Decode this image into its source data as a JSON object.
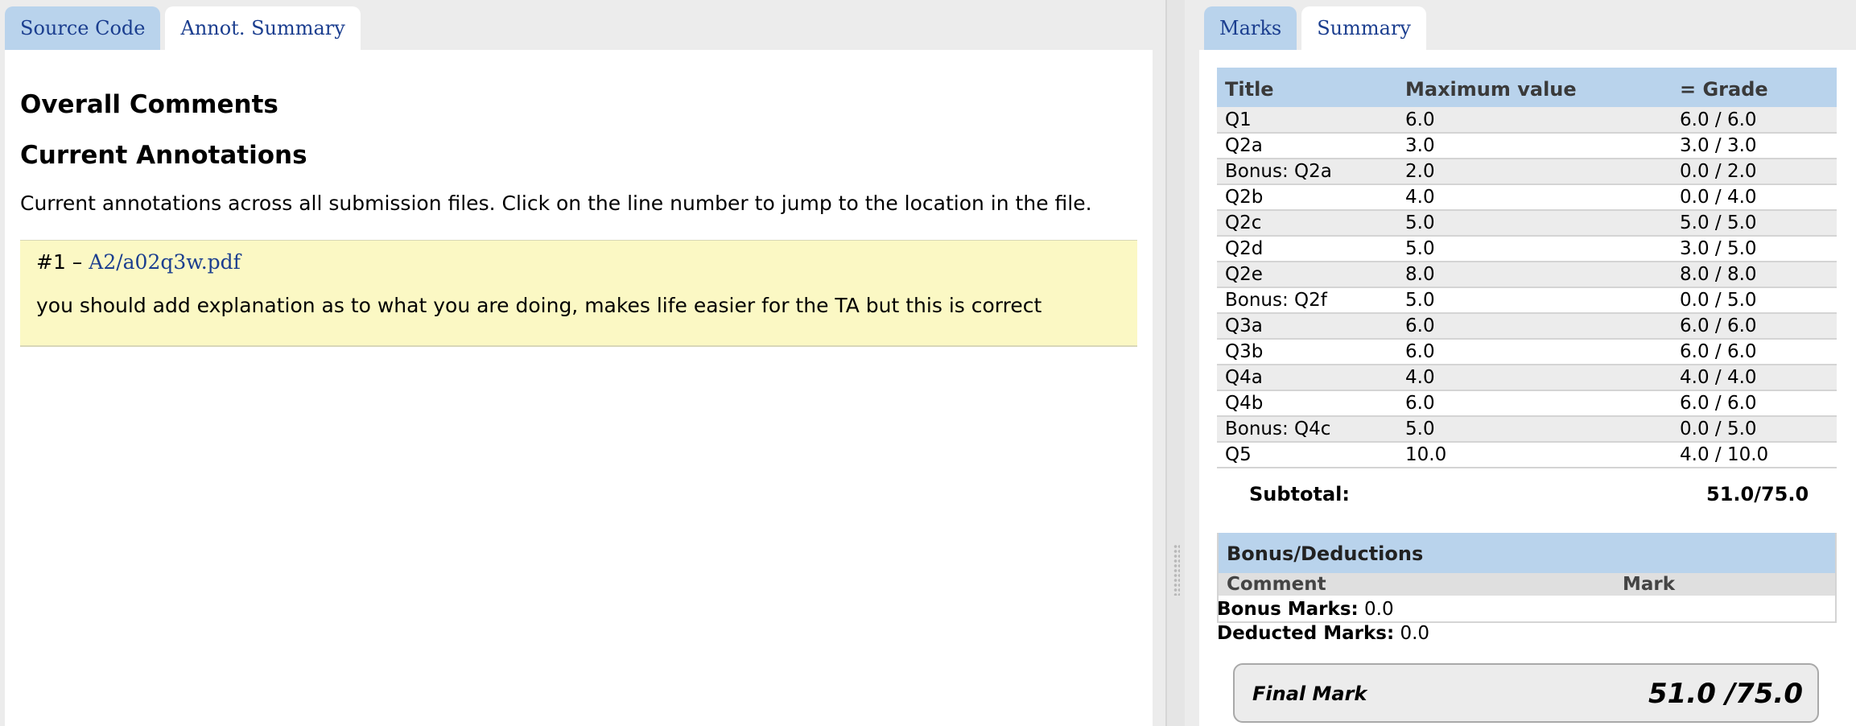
{
  "left_tabs": [
    {
      "label": "Source Code"
    },
    {
      "label": "Annot. Summary"
    }
  ],
  "left": {
    "overall_heading": "Overall Comments",
    "current_heading": "Current Annotations",
    "intro": "Current annotations across all submission files. Click on the line number to jump to the location in the file.",
    "annotation": {
      "number": "#1 –",
      "file_link": "A2/a02q3w.pdf",
      "text": "you should add explanation as to what you are doing, makes life easier for the TA but this is correct"
    }
  },
  "right_tabs": [
    {
      "label": "Marks"
    },
    {
      "label": "Summary"
    }
  ],
  "summary": {
    "headers": {
      "title": "Title",
      "max": "Maximum value",
      "grade": "= Grade"
    },
    "rows": [
      {
        "title": "Q1",
        "max": "6.0",
        "grade": "6.0 / 6.0"
      },
      {
        "title": "Q2a",
        "max": "3.0",
        "grade": "3.0 / 3.0"
      },
      {
        "title": "Bonus: Q2a",
        "max": "2.0",
        "grade": "0.0 / 2.0"
      },
      {
        "title": "Q2b",
        "max": "4.0",
        "grade": "0.0 / 4.0"
      },
      {
        "title": "Q2c",
        "max": "5.0",
        "grade": "5.0 / 5.0"
      },
      {
        "title": "Q2d",
        "max": "5.0",
        "grade": "3.0 / 5.0"
      },
      {
        "title": "Q2e",
        "max": "8.0",
        "grade": "8.0 / 8.0"
      },
      {
        "title": "Bonus: Q2f",
        "max": "5.0",
        "grade": "0.0 / 5.0"
      },
      {
        "title": "Q3a",
        "max": "6.0",
        "grade": "6.0 / 6.0"
      },
      {
        "title": "Q3b",
        "max": "6.0",
        "grade": "6.0 / 6.0"
      },
      {
        "title": "Q4a",
        "max": "4.0",
        "grade": "4.0 / 4.0"
      },
      {
        "title": "Q4b",
        "max": "6.0",
        "grade": "6.0 / 6.0"
      },
      {
        "title": "Bonus: Q4c",
        "max": "5.0",
        "grade": "0.0 / 5.0"
      },
      {
        "title": "Q5",
        "max": "10.0",
        "grade": "4.0 / 10.0"
      }
    ],
    "subtotal_label": "Subtotal:",
    "subtotal_value": "51.0/75.0",
    "bonus_deductions": {
      "heading": "Bonus/Deductions",
      "col_comment": "Comment",
      "col_mark": "Mark",
      "bonus_label": "Bonus Marks:",
      "bonus_value": "0.0",
      "deducted_label": "Deducted Marks:",
      "deducted_value": "0.0"
    },
    "final_label": "Final Mark",
    "final_value": "51.0 /75.0"
  },
  "colors": {
    "tab_inactive": "#b9d3ec",
    "link": "#1b3e8f",
    "annotation_bg": "#fbf8c4",
    "header_bg": "#b9d3ec"
  }
}
